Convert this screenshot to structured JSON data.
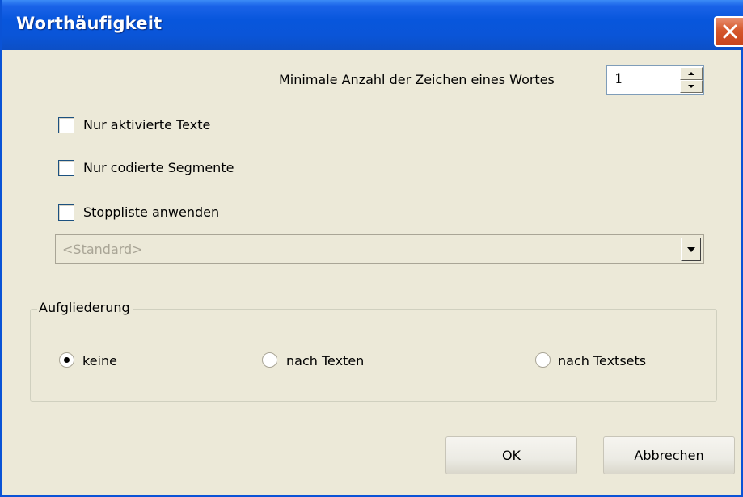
{
  "window": {
    "title": "Worthäufigkeit"
  },
  "min_chars": {
    "label": "Minimale Anzahl der Zeichen eines Wortes",
    "value": "1"
  },
  "options": [
    {
      "label": "Nur aktivierte Texte",
      "checked": false
    },
    {
      "label": "Nur codierte Segmente",
      "checked": false
    },
    {
      "label": "Stoppliste anwenden",
      "checked": false
    }
  ],
  "stoplist_select": {
    "value": "<Standard>",
    "disabled": true
  },
  "breakdown": {
    "legend": "Aufgliederung",
    "options": [
      {
        "label": "keine",
        "selected": true
      },
      {
        "label": "nach Texten",
        "selected": false
      },
      {
        "label": "nach Textsets",
        "selected": false
      }
    ]
  },
  "buttons": {
    "ok": "OK",
    "cancel": "Abbrechen"
  },
  "icons": {
    "close": "close-icon",
    "spin_up": "arrow-up-icon",
    "spin_down": "arrow-down-icon",
    "dropdown": "chevron-down-icon"
  },
  "colors": {
    "titlebar": "#0856dc",
    "dialog_bg": "#ece9d8",
    "close_button": "#d5582c"
  }
}
